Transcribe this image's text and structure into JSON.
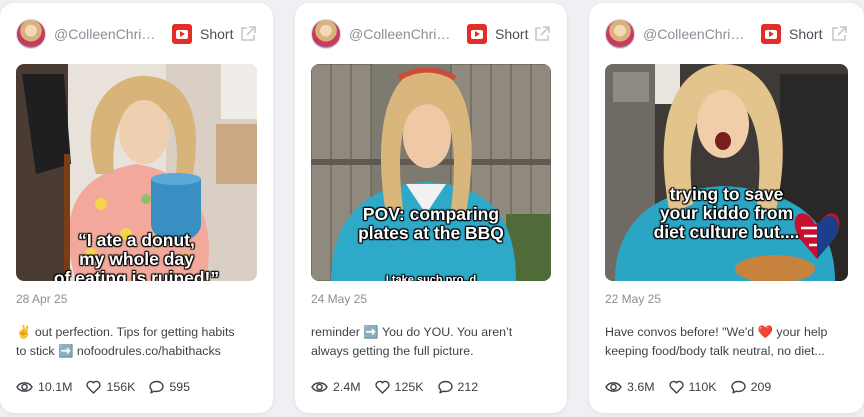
{
  "cards": [
    {
      "handle": "@ColleenChrist...",
      "platform_icon": "youtube-icon",
      "type": "Short",
      "thumb_caption": "“I ate a donut,\nmy whole day\nof eating is ruined!”",
      "date": "28 Apr 25",
      "desc_line1": "✌️ out perfection. Tips for getting habits",
      "desc_line2": "to stick ➡️ nofoodrules.co/habithacks",
      "views": "10.1M",
      "likes": "156K",
      "comments": "595"
    },
    {
      "handle": "@ColleenChrist...",
      "platform_icon": "youtube-icon",
      "type": "Short",
      "thumb_caption": "POV: comparing\nplates at the BBQ",
      "date": "24 May 25",
      "desc_line1": "reminder ➡️ You do YOU. You aren’t",
      "desc_line2": "always getting the full picture.",
      "views": "2.4M",
      "likes": "125K",
      "comments": "212"
    },
    {
      "handle": "@ColleenChrist...",
      "platform_icon": "youtube-icon",
      "type": "Short",
      "thumb_caption": "trying to save\nyour kiddo from\ndiet culture but....",
      "date": "22 May 25",
      "desc_line1": "Have convos before! \"We'd ❤️ your help",
      "desc_line2": "keeping food/body talk neutral, no diet...",
      "views": "3.6M",
      "likes": "110K",
      "comments": "209"
    }
  ],
  "colors": {
    "youtube": "#e52d27",
    "card_bg": "#ffffff",
    "page_bg": "#eef0f4"
  }
}
